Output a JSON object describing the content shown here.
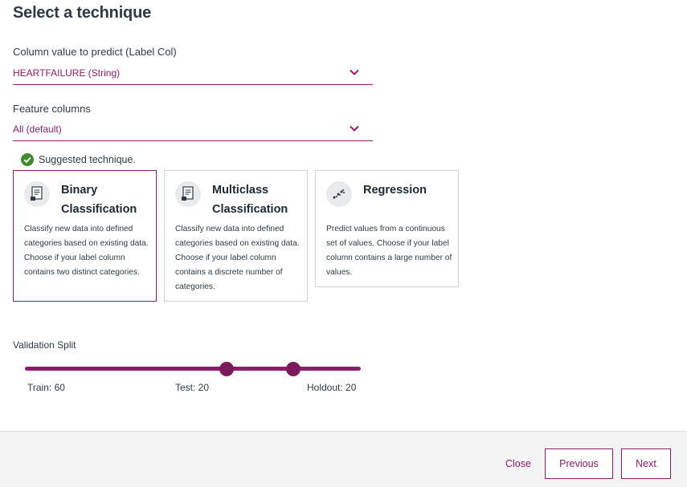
{
  "page": {
    "title": "Select a technique"
  },
  "label_column": {
    "label": "Column value to predict (Label Col)",
    "value": "HEARTFAILURE (String)"
  },
  "feature_columns": {
    "label": "Feature columns",
    "value": "All (default)"
  },
  "suggested": {
    "text": "Suggested technique."
  },
  "techniques": [
    {
      "title_line1": "Binary",
      "title_line2": "Classification",
      "description": "Classify new data into defined categories based on existing data. Choose if your label column contains two distinct categories.",
      "selected": true,
      "icon": "document-tag-icon"
    },
    {
      "title_line1": "Multiclass",
      "title_line2": "Classification",
      "description": "Classify new data into defined categories based on existing data. Choose if your label column contains a discrete number of categories.",
      "selected": false,
      "icon": "document-tag-icon"
    },
    {
      "title_line1": "Regression",
      "title_line2": "",
      "description": "Predict values from a continuous set of values. Choose if your label column contains a large number of values.",
      "selected": false,
      "icon": "scatter-regression-icon"
    }
  ],
  "validation_split": {
    "label": "Validation Split",
    "train_label": "Train: 60",
    "test_label": "Test: 20",
    "holdout_label": "Holdout: 20",
    "train": 60,
    "test": 20,
    "holdout": 20
  },
  "footer": {
    "close": "Close",
    "previous": "Previous",
    "next": "Next"
  },
  "colors": {
    "accent": "#8c1d68",
    "success": "#3f8a2d",
    "text": "#2f3b45",
    "footer_bg": "#f4f4f5"
  }
}
